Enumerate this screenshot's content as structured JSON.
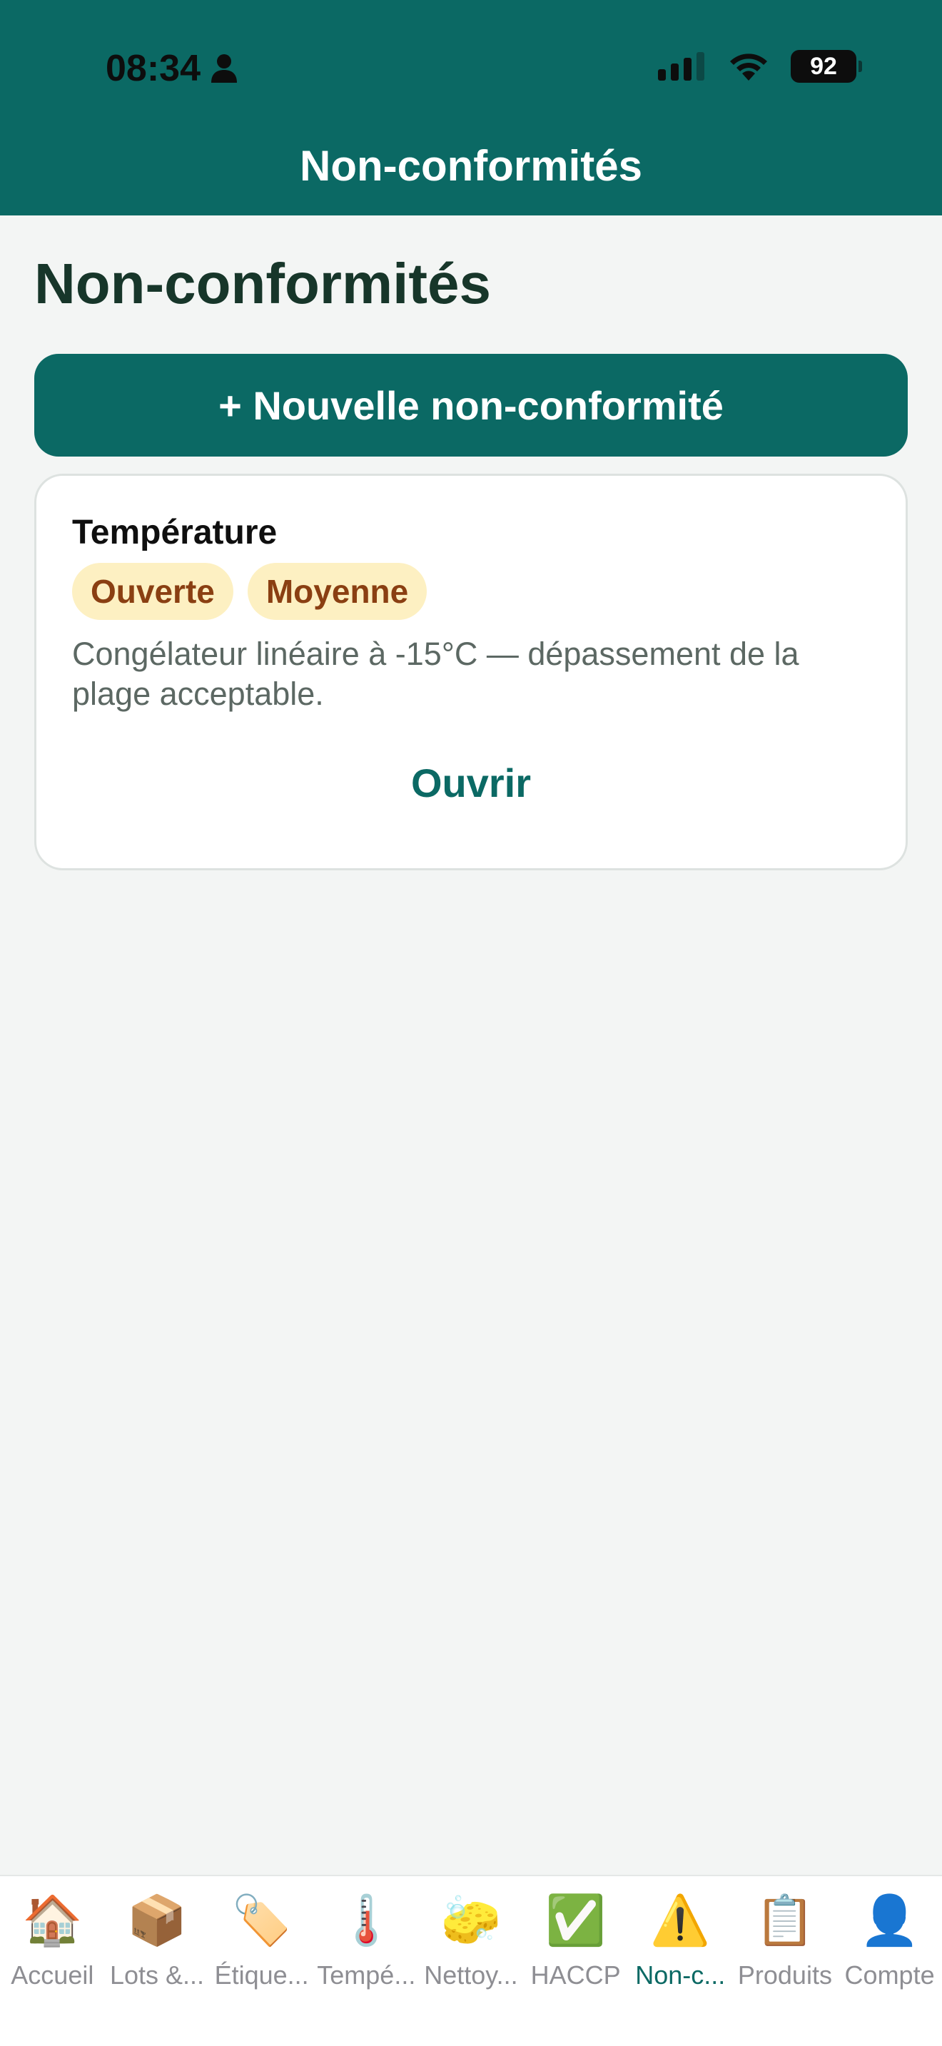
{
  "status_bar": {
    "time": "08:34",
    "battery": "92"
  },
  "header": {
    "title": "Non-conformités"
  },
  "page": {
    "title": "Non-conformités",
    "new_button_label": "+ Nouvelle non-conformité"
  },
  "card": {
    "title": "Température",
    "badges": [
      "Ouverte",
      "Moyenne"
    ],
    "description": "Congélateur linéaire à -15°C — dépassement de la plage acceptable.",
    "action_label": "Ouvrir"
  },
  "tabbar": {
    "items": [
      {
        "label": "Accueil",
        "icon": "🏠",
        "icon_name": "house-icon"
      },
      {
        "label": "Lots &...",
        "icon": "📦",
        "icon_name": "package-icon"
      },
      {
        "label": "Étique...",
        "icon": "🏷️",
        "icon_name": "label-tag-icon"
      },
      {
        "label": "Tempé...",
        "icon": "🌡️",
        "icon_name": "thermometer-icon"
      },
      {
        "label": "Nettoy...",
        "icon": "🧽",
        "icon_name": "sponge-icon"
      },
      {
        "label": "HACCP",
        "icon": "✅",
        "icon_name": "check-mark-icon"
      },
      {
        "label": "Non-c...",
        "icon": "⚠️",
        "icon_name": "warning-icon",
        "active": true
      },
      {
        "label": "Produits",
        "icon": "📋",
        "icon_name": "clipboard-icon"
      },
      {
        "label": "Compte",
        "icon": "👤",
        "icon_name": "user-icon"
      }
    ]
  },
  "colors": {
    "primary": "#0b6964",
    "background": "#f3f5f4",
    "badge_bg": "#fdf0c2",
    "badge_text": "#8a3f12",
    "title_text": "#17362a"
  }
}
